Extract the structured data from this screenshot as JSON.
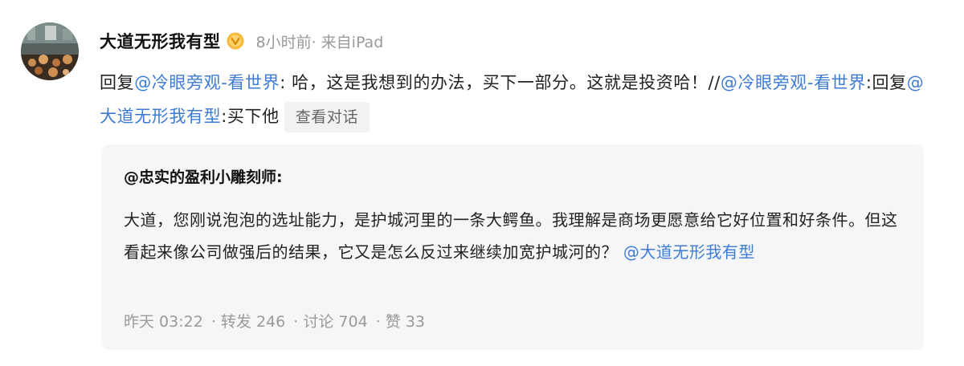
{
  "post": {
    "username": "大道无形我有型",
    "badge_icon": "gold-v-badge",
    "meta": "8小时前· 来自iPad",
    "body": {
      "reply_prefix": "回复",
      "mention1": "@冷眼旁观-看世界",
      "text1": ": 哈，这是我想到的办法，买下一部分。这就是投资哈！//",
      "mention2": "@冷眼旁观-看世界",
      "text2": ":回复",
      "mention3": "@大道无形我有型",
      "text3": ":买下他"
    },
    "view_dialog_label": "查看对话"
  },
  "quote": {
    "author": "@忠实的盈利小雕刻师:",
    "text": "大道，您刚说泡泡的选址能力，是护城河里的一条大鳄鱼。我理解是商场更愿意给它好位置和好条件。但这看起来像公司做强后的结果，它又是怎么反过来继续加宽护城河的？",
    "mention": "@大道无形我有型",
    "time": "昨天 03:22",
    "repost": "· 转发 246",
    "comment": "· 讨论 704",
    "like": "· 赞 33"
  },
  "colors": {
    "accent": "#3e7cd4",
    "meta": "#9a9a9a",
    "quote_bg": "#f5f6f8"
  }
}
